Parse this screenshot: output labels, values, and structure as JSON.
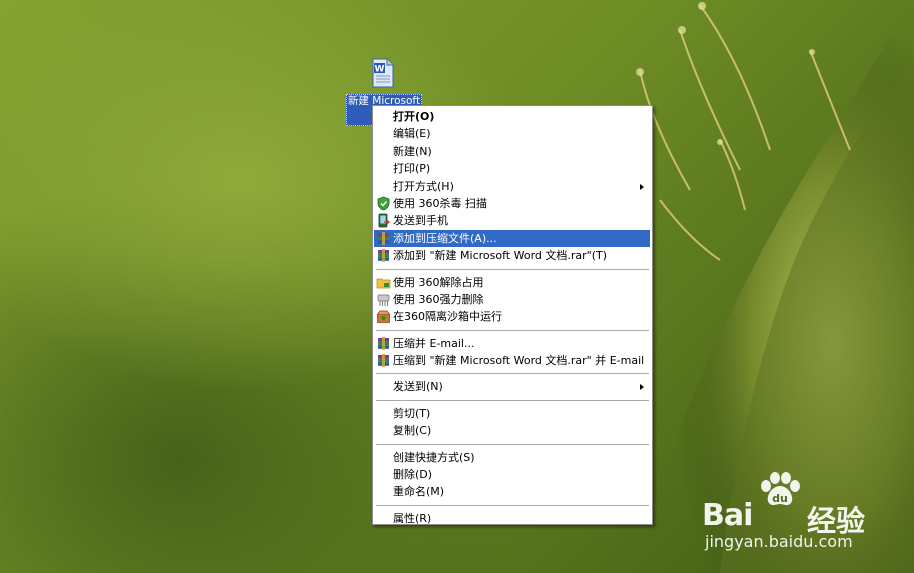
{
  "desktop": {
    "file_icon_label": "新建 Microsoft Wo"
  },
  "context_menu": {
    "items": [
      {
        "label": "打开(O)",
        "icon": "",
        "bold": true,
        "submenu": false
      },
      {
        "label": "编辑(E)",
        "icon": "",
        "submenu": false
      },
      {
        "label": "新建(N)",
        "icon": "",
        "submenu": false
      },
      {
        "label": "打印(P)",
        "icon": "",
        "submenu": false
      },
      {
        "label": "打开方式(H)",
        "icon": "",
        "submenu": true
      },
      {
        "label": "使用 360杀毒 扫描",
        "icon": "360-antivirus-shield-icon",
        "submenu": false
      },
      {
        "label": "发送到手机",
        "icon": "send-to-phone-icon",
        "submenu": false
      },
      {
        "label": "添加到压缩文件(A)...",
        "icon": "winrar-archive-icon",
        "submenu": false,
        "highlighted": true
      },
      {
        "label": "添加到 \"新建 Microsoft Word 文档.rar\"(T)",
        "icon": "winrar-archive-icon",
        "submenu": false
      },
      {
        "label": "使用 360解除占用",
        "icon": "360-unlock-folder-icon",
        "submenu": false,
        "group_start": true
      },
      {
        "label": "使用 360强力删除",
        "icon": "360-shredder-icon",
        "submenu": false
      },
      {
        "label": "在360隔离沙箱中运行",
        "icon": "360-sandbox-box-icon",
        "submenu": false
      },
      {
        "label": "压缩并 E-mail...",
        "icon": "winrar-archive-icon",
        "submenu": false,
        "group_start": true
      },
      {
        "label": "压缩到 \"新建 Microsoft Word 文档.rar\" 并 E-mail",
        "icon": "winrar-archive-icon",
        "submenu": false
      },
      {
        "label": "发送到(N)",
        "icon": "",
        "submenu": true,
        "group_start": true
      },
      {
        "label": "剪切(T)",
        "icon": "",
        "submenu": false,
        "group_start": true
      },
      {
        "label": "复制(C)",
        "icon": "",
        "submenu": false
      },
      {
        "label": "创建快捷方式(S)",
        "icon": "",
        "submenu": false,
        "group_start": true
      },
      {
        "label": "删除(D)",
        "icon": "",
        "submenu": false
      },
      {
        "label": "重命名(M)",
        "icon": "",
        "submenu": false
      },
      {
        "label": "属性(R)",
        "icon": "",
        "submenu": false,
        "group_start": true
      }
    ],
    "highlight_color": "#316ac5"
  },
  "watermark": {
    "brand_left": "Bai",
    "brand_right": "经验",
    "url": "jingyan.baidu.com"
  }
}
